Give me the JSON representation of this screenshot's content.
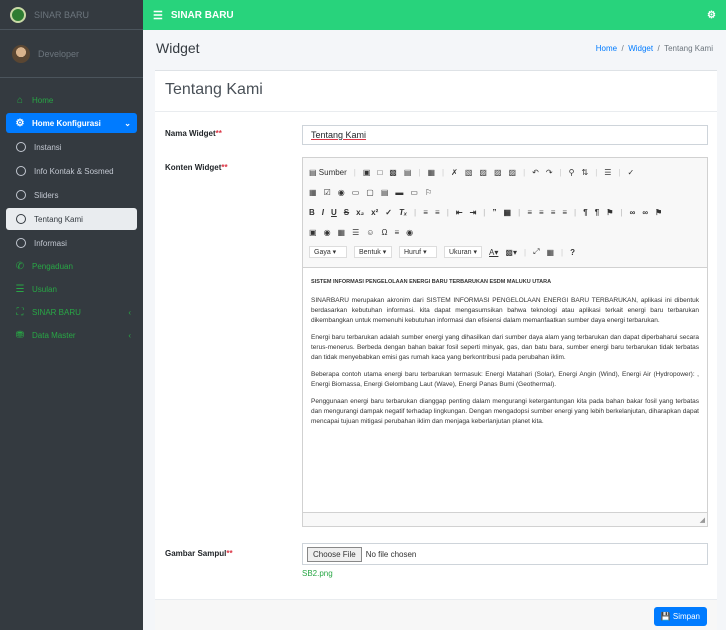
{
  "app": {
    "brand": "SINAR BARU",
    "topbar_title": "SINAR BARU"
  },
  "user": {
    "name": "Developer"
  },
  "sidebar": {
    "items": [
      {
        "label": "Home",
        "icon": "home-icon"
      },
      {
        "label": "Home Konfigurasi",
        "icon": "gears-icon",
        "active": true
      },
      {
        "label": "Instansi",
        "icon": "circle-icon"
      },
      {
        "label": "Info Kontak & Sosmed",
        "icon": "circle-icon"
      },
      {
        "label": "Sliders",
        "icon": "circle-icon"
      },
      {
        "label": "Tentang Kami",
        "icon": "circle-icon",
        "selected": true
      },
      {
        "label": "Informasi",
        "icon": "circle-icon"
      },
      {
        "label": "Pengaduan",
        "icon": "phone-icon"
      },
      {
        "label": "Usulan",
        "icon": "list-icon"
      },
      {
        "label": "SINAR BARU",
        "icon": "road-icon"
      },
      {
        "label": "Data Master",
        "icon": "database-icon"
      }
    ]
  },
  "header": {
    "page_title": "Widget",
    "breadcrumb": [
      "Home",
      "Widget",
      "Tentang Kami"
    ]
  },
  "form": {
    "card_title": "Tentang Kami",
    "name_label": "Nama Widget",
    "name_value": "Tentang Kami",
    "content_label": "Konten Widget",
    "image_label": "Gambar Sampul",
    "required_mark": "**",
    "file_button": "Choose File",
    "file_status": "No file chosen",
    "file_current": "SB2.png",
    "save_label": "Simpan"
  },
  "editor": {
    "source_label": "Sumber",
    "style_select": "Gaya",
    "format_select": "Bentuk",
    "font_select": "Huruf",
    "size_select": "Ukuran",
    "heading": "SISTEM INFORMASI PENGELOLAAN ENERGI BARU TERBARUKAN ESDM MALUKU UTARA",
    "paragraphs": [
      "SINARBARU merupakan akronim dari SISTEM INFORMASI PENGELOLAAN ENERGI BARU TERBARUKAN, aplikasi ini dibentuk berdasarkan kebutuhan informasi. kita dapat mengasumsikan bahwa teknologi atau aplikasi terkait energi baru terbarukan dikembangkan untuk memenuhi kebutuhan informasi dan efisiensi dalam memanfaatkan sumber daya energi terbarukan.",
      "Energi baru terbarukan adalah sumber energi yang dihasilkan dari sumber daya alam yang terbarukan dan dapat diperbaharui secara terus-menerus. Berbeda dengan bahan bakar fosil seperti minyak, gas, dan batu bara, sumber energi baru terbarukan tidak terbatas dan tidak menyebabkan emisi gas rumah kaca yang berkontribusi pada perubahan iklim.",
      "Beberapa contoh utama energi baru terbarukan termasuk: Energi Matahari (Solar), Energi Angin (Wind), Energi Air (Hydropower): , Energi Biomassa, Energi Gelombang Laut (Wave), Energi Panas Bumi (Geothermal).",
      "Penggunaan energi baru terbarukan dianggap penting dalam mengurangi ketergantungan kita pada bahan bakar fosil yang terbatas dan mengurangi dampak negatif terhadap lingkungan. Dengan mengadopsi sumber energi yang lebih berkelanjutan, diharapkan dapat mencapai tujuan mitigasi perubahan iklim dan menjaga keberlanjutan planet kita."
    ]
  },
  "colors": {
    "topbar": "#28d37c",
    "sidebar": "#343a40",
    "accent": "#007bff",
    "nav_text": "#28a745"
  }
}
